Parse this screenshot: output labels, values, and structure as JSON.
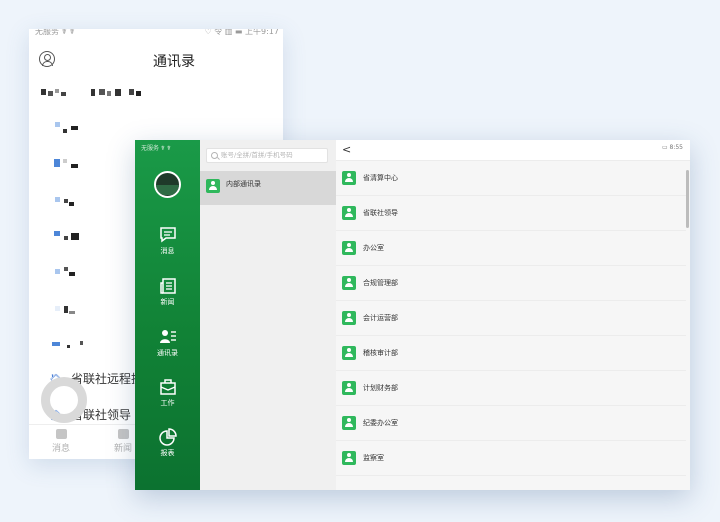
{
  "phone": {
    "status_left": "无服务 ☤ ☤",
    "status_right": "♡ 令 ▥ ▬ 上午9:17",
    "title": "通讯录",
    "rows": [
      {
        "label": "省联社远程投"
      },
      {
        "label": "省联社领导"
      }
    ],
    "tabs": [
      {
        "label": "消息"
      },
      {
        "label": "新闻"
      }
    ]
  },
  "tablet": {
    "status_left": "无服务 ☤ ☤",
    "status_right": "▭ 8:55",
    "search_placeholder": "账号/全拼/首拼/手机号码",
    "back_symbol": "<",
    "nav": [
      {
        "label": "消息",
        "icon": "chat-icon"
      },
      {
        "label": "新闻",
        "icon": "news-icon"
      },
      {
        "label": "通讯录",
        "icon": "contacts-icon"
      },
      {
        "label": "工作",
        "icon": "briefcase-icon"
      },
      {
        "label": "报表",
        "icon": "pie-chart-icon"
      }
    ],
    "left_list": [
      {
        "label": "内部通讯录"
      }
    ],
    "departments": [
      {
        "label": "省清算中心"
      },
      {
        "label": "省联社领导"
      },
      {
        "label": "办公室"
      },
      {
        "label": "合规管理部"
      },
      {
        "label": "会计运营部"
      },
      {
        "label": "稽核审计部"
      },
      {
        "label": "计划财务部"
      },
      {
        "label": "纪委办公室"
      },
      {
        "label": "监察室"
      }
    ]
  },
  "colors": {
    "sidebar_green": "#118236",
    "icon_green": "#2fb85c",
    "background": "#eef4fb"
  }
}
